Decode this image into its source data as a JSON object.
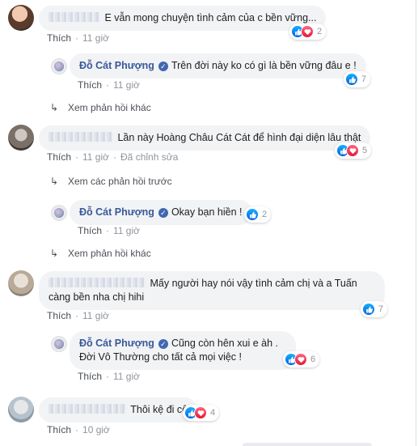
{
  "labels": {
    "like": "Thích",
    "dot": "·"
  },
  "colors": {
    "name_link": "#385898",
    "bubble_bg": "#f2f3f5",
    "meta_text": "#90949c",
    "like_blue": "#2078f4",
    "love_red": "#f33e58"
  },
  "icons": {
    "like": "thumbs-up-icon",
    "love": "heart-icon",
    "verified": "verified-badge-icon",
    "reply_arrow": "reply-arrow-icon"
  },
  "comments": [
    {
      "text": "E vẫn mong chuyện tình cảm của c bền vững...",
      "time": "11 giờ",
      "reaction_count": "2"
    },
    {
      "text": "Lần này Hoàng Châu Cát Cát để hình đại diện lâu thật",
      "time": "11 giờ",
      "edited": "Đã chỉnh sửa",
      "reaction_count": "5"
    },
    {
      "text_line1": "Mấy người hay nói vậy tình cảm chị và a Tuấn",
      "text_line2": "càng bền nha chị hihi",
      "time": "11 giờ",
      "reaction_count": "7"
    },
    {
      "text": "Thôi kệ đi cô",
      "time": "10 giờ",
      "reaction_count": "4"
    }
  ],
  "replies": [
    {
      "name": "Đỗ Cát Phượng",
      "text": "Trên đời này ko có gì là bền vững đâu e !",
      "time": "11 giờ",
      "reaction_count": "7"
    },
    {
      "name": "Đỗ Cát Phượng",
      "text": "Okay bạn hiền !",
      "time": "11 giờ",
      "reaction_count": "2"
    },
    {
      "name": "Đỗ Cát Phượng",
      "text_line1": "Cũng còn hên xui e àh .",
      "text_line2": "Đời Vô Thường cho tất cả mọi việc !",
      "time": "11 giờ",
      "reaction_count": "6"
    }
  ],
  "links": {
    "more_replies": "Xem phản hồi khác",
    "previous_replies": "Xem các phản hồi trước"
  }
}
